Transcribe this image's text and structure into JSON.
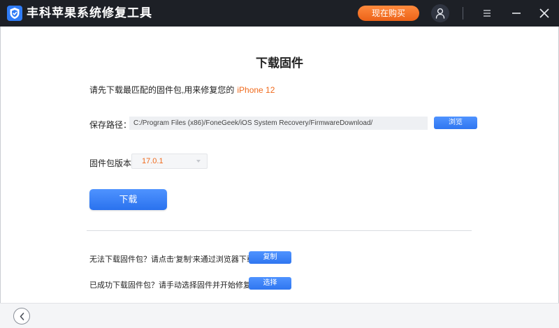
{
  "app": {
    "title_part1": "丰科",
    "title_part2": "苹果系统修复工具"
  },
  "header": {
    "buy_button": "现在购买",
    "icons": [
      "shield-logo-icon",
      "user-icon",
      "menu-icon",
      "minimize-icon",
      "close-icon"
    ]
  },
  "page": {
    "title": "下载固件",
    "intro_text": "请先下载最匹配的固件包,用来修复您的",
    "device_name": "iPhone 12"
  },
  "save_path": {
    "label": "保存路径：",
    "value": "C:/Program Files (x86)/FoneGeek/iOS System Recovery/FirmwareDownload/",
    "browse_button": "浏览"
  },
  "firmware_version": {
    "label": "固件包版本：",
    "selected": "17.0.1"
  },
  "download_button": "下载",
  "help": {
    "copy_text": "无法下载固件包？请点击‘复制’来通过浏览器下载",
    "copy_button": "复制",
    "select_text": "已成功下载固件包？请手动选择固件并开始修复",
    "select_button": "选择"
  },
  "colors": {
    "titlebar_bg": "#1d2026",
    "accent_blue": "#2f76f0",
    "accent_orange": "#f06a1c",
    "buy_button": "#ec6218"
  }
}
